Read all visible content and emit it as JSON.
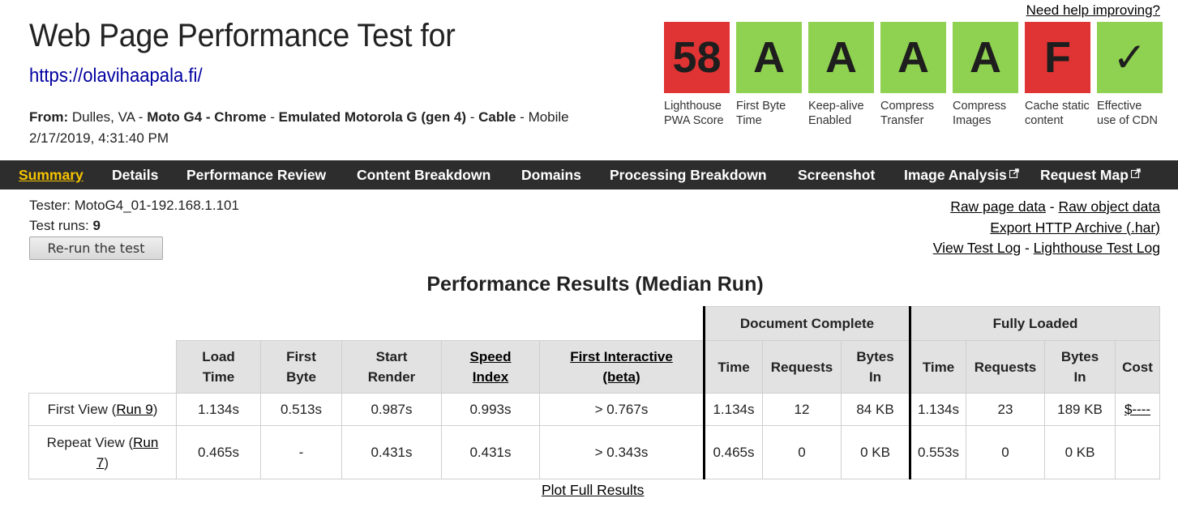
{
  "header": {
    "title": "Web Page Performance Test for",
    "url": "https://olavihaapala.fi/",
    "from_label": "From:",
    "location": "Dulles, VA",
    "device": "Moto G4 - Chrome",
    "emulation": "Emulated Motorola G (gen 4)",
    "connection": "Cable",
    "mode": "Mobile",
    "datetime": "2/17/2019, 4:31:40 PM",
    "help_link": "Need help improving?"
  },
  "grades": [
    {
      "value": "58",
      "label": "Lighthouse PWA Score",
      "color": "#e03333"
    },
    {
      "value": "A",
      "label": "First Byte Time",
      "color": "#8fd150"
    },
    {
      "value": "A",
      "label": "Keep-alive Enabled",
      "color": "#8fd150"
    },
    {
      "value": "A",
      "label": "Compress Transfer",
      "color": "#8fd150"
    },
    {
      "value": "A",
      "label": "Compress Images",
      "color": "#8fd150"
    },
    {
      "value": "F",
      "label": "Cache static content",
      "color": "#e03333"
    },
    {
      "value": "✓",
      "label": "Effective use of CDN",
      "color": "#8fd150"
    }
  ],
  "nav": {
    "items": [
      "Summary",
      "Details",
      "Performance Review",
      "Content Breakdown",
      "Domains",
      "Processing Breakdown",
      "Screenshot",
      "Image Analysis",
      "Request Map"
    ],
    "active": "Summary",
    "accent": "#f5c400"
  },
  "info": {
    "tester": "Tester: MotoG4_01-192.168.1.101",
    "runs_label": "Test runs:",
    "runs_value": "9",
    "rerun_button": "Re-run the test"
  },
  "links": {
    "raw_page": "Raw page data",
    "raw_object": "Raw object data",
    "export_har": "Export HTTP Archive (.har)",
    "view_log": "View Test Log",
    "lighthouse_log": "Lighthouse Test Log",
    "separator": "-"
  },
  "results": {
    "title": "Performance Results (Median Run)",
    "group_document": "Document Complete",
    "group_fully": "Fully Loaded",
    "columns": {
      "load_time": "Load Time",
      "first_byte": "First Byte",
      "start_render": "Start Render",
      "speed_index": "Speed Index",
      "first_interactive": "First Interactive (beta)",
      "doc_time": "Time",
      "doc_requests": "Requests",
      "doc_bytes": "Bytes In",
      "full_time": "Time",
      "full_requests": "Requests",
      "full_bytes": "Bytes In",
      "cost": "Cost"
    },
    "rows": [
      {
        "label": "First View (",
        "run_link": "Run 9",
        "label_end": ")",
        "load_time": "1.134s",
        "first_byte": "0.513s",
        "start_render": "0.987s",
        "speed_index": "0.993s",
        "first_interactive": "> 0.767s",
        "doc_time": "1.134s",
        "doc_requests": "12",
        "doc_bytes": "84 KB",
        "full_time": "1.134s",
        "full_requests": "23",
        "full_bytes": "189 KB",
        "cost": "$----"
      },
      {
        "label": "Repeat View (",
        "run_link_1": "Run",
        "run_link_2": "7",
        "label_end": ")",
        "load_time": "0.465s",
        "first_byte": "-",
        "start_render": "0.431s",
        "speed_index": "0.431s",
        "first_interactive": "> 0.343s",
        "doc_time": "0.465s",
        "doc_requests": "0",
        "doc_bytes": "0 KB",
        "full_time": "0.553s",
        "full_requests": "0",
        "full_bytes": "0 KB",
        "cost": ""
      }
    ],
    "plot_link": "Plot Full Results"
  }
}
